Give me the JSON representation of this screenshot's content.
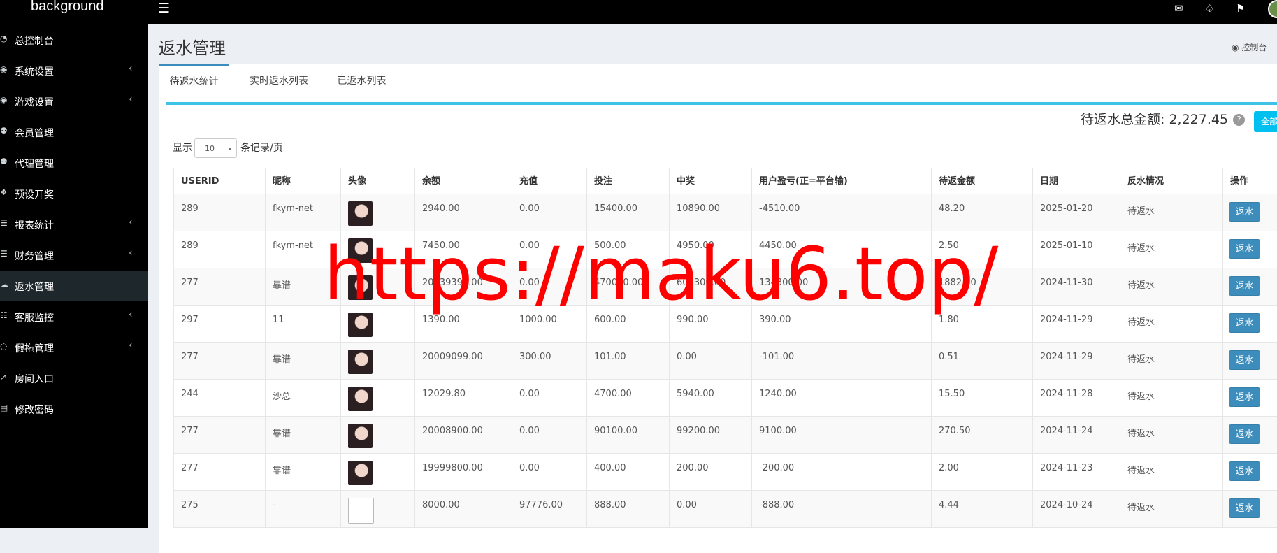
{
  "topbar": {
    "brand": "background",
    "menu_icon": "hamburger-icon",
    "icons": [
      "mail-icon",
      "bell-icon",
      "flag-icon"
    ]
  },
  "sidebar": {
    "items": [
      {
        "label": "总控制台",
        "icon": "dashboard-icon",
        "arrow": false,
        "active": false
      },
      {
        "label": "系统设置",
        "icon": "gamepad-icon",
        "arrow": true,
        "active": false
      },
      {
        "label": "游戏设置",
        "icon": "gamepad-icon",
        "arrow": true,
        "active": false
      },
      {
        "label": "会员管理",
        "icon": "users-icon",
        "arrow": false,
        "active": false
      },
      {
        "label": "代理管理",
        "icon": "users-icon",
        "arrow": false,
        "active": false
      },
      {
        "label": "预设开奖",
        "icon": "cubes-icon",
        "arrow": false,
        "active": false
      },
      {
        "label": "报表统计",
        "icon": "list-icon",
        "arrow": true,
        "active": false
      },
      {
        "label": "财务管理",
        "icon": "database-icon",
        "arrow": true,
        "active": false
      },
      {
        "label": "返水管理",
        "icon": "cloud-download-icon",
        "arrow": false,
        "active": true
      },
      {
        "label": "客服监控",
        "icon": "chat-icon",
        "arrow": true,
        "active": false
      },
      {
        "label": "假拖管理",
        "icon": "comment-icon",
        "arrow": true,
        "active": false
      },
      {
        "label": "房间入口",
        "icon": "external-link-icon",
        "arrow": false,
        "active": false
      },
      {
        "label": "修改密码",
        "icon": "cart-icon",
        "arrow": false,
        "active": false
      }
    ]
  },
  "header": {
    "title": "返水管理",
    "breadcrumb": "控制台"
  },
  "tabs": [
    {
      "label": "待返水统计"
    },
    {
      "label": "实时返水列表"
    },
    {
      "label": "已返水列表"
    }
  ],
  "summary": {
    "total_label": "待返水总金额:",
    "total_value": "2,227.45",
    "all_button": "全部"
  },
  "pagination": {
    "show_label": "显示",
    "per_page": "10",
    "per_page_suffix": "条记录/页"
  },
  "table": {
    "headers": [
      "USERID",
      "昵称",
      "头像",
      "余额",
      "充值",
      "投注",
      "中奖",
      "用户盈亏(正=平台输)",
      "待返金额",
      "日期",
      "反水情况",
      "操作"
    ],
    "rows": [
      {
        "userid": "289",
        "nick": "fkym-net",
        "avatar": "photo",
        "balance": "2940.00",
        "recharge": "0.00",
        "bet": "15400.00",
        "win": "10890.00",
        "profit": "-4510.00",
        "pending": "48.20",
        "date": "2025-01-20",
        "status": "待返水",
        "action": "返水"
      },
      {
        "userid": "289",
        "nick": "fkym-net",
        "avatar": "photo",
        "balance": "7450.00",
        "recharge": "0.00",
        "bet": "500.00",
        "win": "4950.00",
        "profit": "4450.00",
        "pending": "2.50",
        "date": "2025-01-10",
        "status": "待返水",
        "action": "返水"
      },
      {
        "userid": "277",
        "nick": "靠谱",
        "avatar": "photo",
        "balance": "20039399.00",
        "recharge": "0.00",
        "bet": "470000.00",
        "win": "604300.00",
        "profit": "134300.00",
        "pending": "1882.00",
        "date": "2024-11-30",
        "status": "待返水",
        "action": "返水"
      },
      {
        "userid": "297",
        "nick": "11",
        "avatar": "photo",
        "balance": "1390.00",
        "recharge": "1000.00",
        "bet": "600.00",
        "win": "990.00",
        "profit": "390.00",
        "pending": "1.80",
        "date": "2024-11-29",
        "status": "待返水",
        "action": "返水"
      },
      {
        "userid": "277",
        "nick": "靠谱",
        "avatar": "photo",
        "balance": "20009099.00",
        "recharge": "300.00",
        "bet": "101.00",
        "win": "0.00",
        "profit": "-101.00",
        "pending": "0.51",
        "date": "2024-11-29",
        "status": "待返水",
        "action": "返水"
      },
      {
        "userid": "244",
        "nick": "沙总",
        "avatar": "photo",
        "balance": "12029.80",
        "recharge": "0.00",
        "bet": "4700.00",
        "win": "5940.00",
        "profit": "1240.00",
        "pending": "15.50",
        "date": "2024-11-28",
        "status": "待返水",
        "action": "返水"
      },
      {
        "userid": "277",
        "nick": "靠谱",
        "avatar": "photo",
        "balance": "20008900.00",
        "recharge": "0.00",
        "bet": "90100.00",
        "win": "99200.00",
        "profit": "9100.00",
        "pending": "270.50",
        "date": "2024-11-24",
        "status": "待返水",
        "action": "返水"
      },
      {
        "userid": "277",
        "nick": "靠谱",
        "avatar": "photo",
        "balance": "19999800.00",
        "recharge": "0.00",
        "bet": "400.00",
        "win": "200.00",
        "profit": "-200.00",
        "pending": "2.00",
        "date": "2024-11-23",
        "status": "待返水",
        "action": "返水"
      },
      {
        "userid": "275",
        "nick": "-",
        "avatar": "empty",
        "balance": "8000.00",
        "recharge": "97776.00",
        "bet": "888.00",
        "win": "0.00",
        "profit": "-888.00",
        "pending": "4.44",
        "date": "2024-10-24",
        "status": "待返水",
        "action": "返水"
      }
    ]
  },
  "watermark": "https://maku6.top/",
  "colors": {
    "primary": "#3c8dbc",
    "accent": "#3cc3e6",
    "watermark": "#ff0000",
    "sidebar_bg": "#000000"
  }
}
